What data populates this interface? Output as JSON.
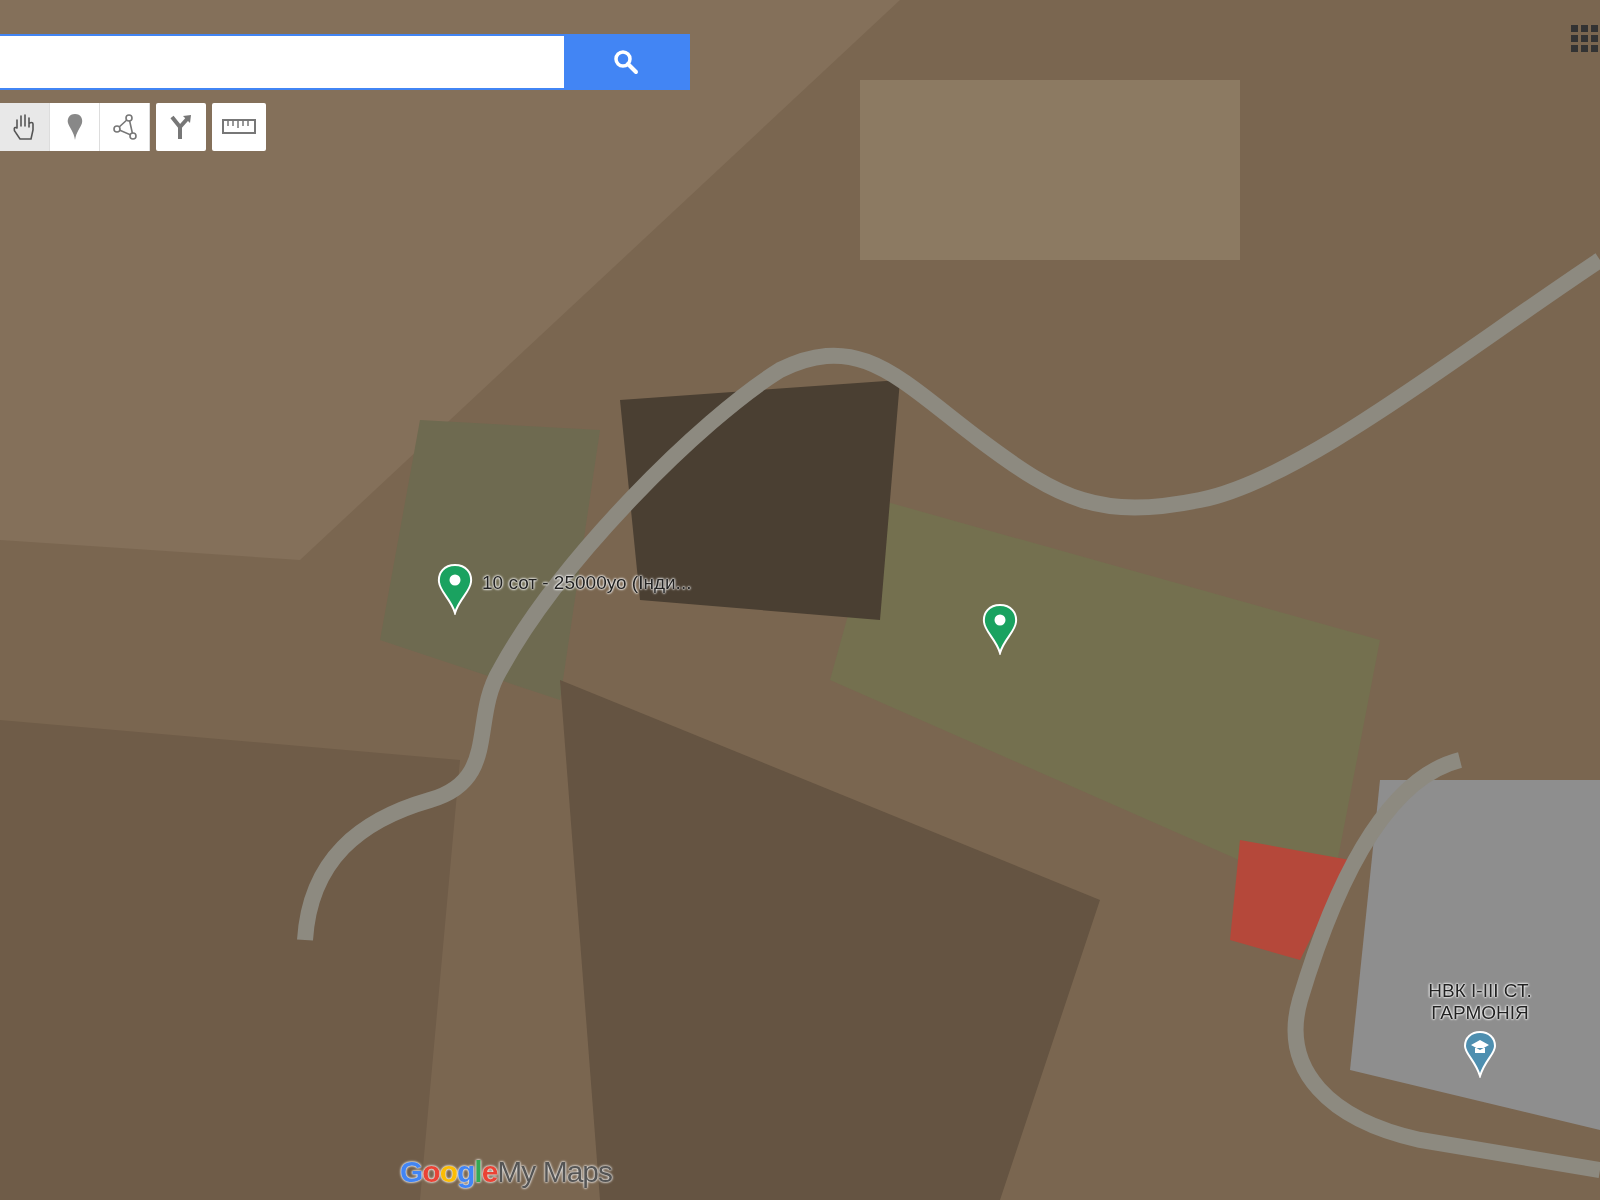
{
  "tools": [
    {
      "kind": "hand",
      "selected": true
    },
    {
      "kind": "marker",
      "selected": false
    },
    {
      "kind": "line",
      "selected": false
    },
    {
      "kind": "directions",
      "selected": false
    },
    {
      "kind": "ruler",
      "selected": false
    }
  ],
  "markers": [
    {
      "kind": "pin",
      "color": "#1aa260",
      "label": "10 сот - 25000уо (Інди..."
    },
    {
      "kind": "pin",
      "color": "#1aa260"
    },
    {
      "kind": "school",
      "color": "#4e8fb0",
      "label": "НВК І-ІІІ СТ. ГАРМОНІЯ"
    }
  ],
  "logo": {
    "brand": "Google",
    "product": "My Maps"
  }
}
